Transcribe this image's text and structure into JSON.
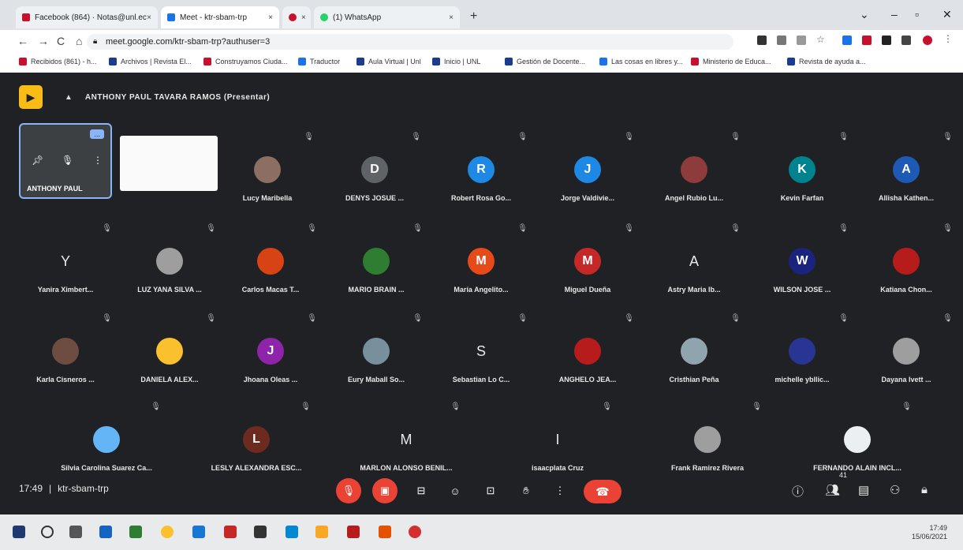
{
  "browser": {
    "tabs": [
      {
        "label": "Facebook (864) · Notas@unl.ec",
        "fav": "#c8102e",
        "active": false
      },
      {
        "label": "Meet - ktr-sbam-trp",
        "fav": "#1a73e8",
        "active": true
      },
      {
        "label": "",
        "fav": "#c8102e",
        "active": false
      },
      {
        "label": "(1) WhatsApp",
        "fav": "#25d366",
        "active": false
      }
    ],
    "url": "meet.google.com/ktr-sbam-trp?authuser=3",
    "bookmarks": [
      {
        "label": "Recibidos (861) - h...",
        "color": "#c8102e"
      },
      {
        "label": "Archivos | Revista El...",
        "color": "#1a3c8c"
      },
      {
        "label": "Construyamos Ciuda...",
        "color": "#c8102e"
      },
      {
        "label": "Traductor",
        "color": "#1a73e8"
      },
      {
        "label": "Aula Virtual | Unl",
        "color": "#1a3c8c"
      },
      {
        "label": "Inicio | UNL",
        "color": "#1a3c8c"
      },
      {
        "label": "Gestión de Docente...",
        "color": "#1a3c8c"
      },
      {
        "label": "Las cosas en libres y...",
        "color": "#1a73e8"
      },
      {
        "label": "Ministerio de Educa...",
        "color": "#c8102e"
      },
      {
        "label": "Revista de ayuda a...",
        "color": "#1a3c8c"
      }
    ]
  },
  "meet": {
    "presenter": "ANTHONY PAUL TAVARA RAMOS (Presentar)",
    "self_name": "ANTHONY PAUL",
    "self_badge": "...",
    "participants": [
      {
        "name": "Lucy Maribella",
        "initial": "",
        "color": "#8d6e63"
      },
      {
        "name": "DENYS JOSUE ...",
        "initial": "D",
        "color": "#5f6368"
      },
      {
        "name": "Robert Rosa Go...",
        "initial": "R",
        "color": "#1e88e5"
      },
      {
        "name": "Jorge Valdivie...",
        "initial": "J",
        "color": "#1e88e5"
      },
      {
        "name": "Angel Rubio Lu...",
        "initial": "",
        "color": "#8e3b3b"
      },
      {
        "name": "Kevin Farfan",
        "initial": "K",
        "color": "#00838f"
      },
      {
        "name": "Allisha Kathen...",
        "initial": "A",
        "color": "#1e5ab4"
      },
      {
        "name": "Yanira Ximbert...",
        "initial": "Y",
        "color": "letter"
      },
      {
        "name": "LUZ YANA SILVA ...",
        "initial": "",
        "color": "#9e9e9e"
      },
      {
        "name": "Carlos Macas T...",
        "initial": "",
        "color": "#d84315"
      },
      {
        "name": "MARIO BRAIN ...",
        "initial": "",
        "color": "#2e7d32"
      },
      {
        "name": "María Angelito...",
        "initial": "M",
        "color": "#e64a19"
      },
      {
        "name": "Miguel Dueña",
        "initial": "M",
        "color": "#c62828"
      },
      {
        "name": "Astry Maria Ib...",
        "initial": "A",
        "color": "letter"
      },
      {
        "name": "WILSON JOSE ...",
        "initial": "W",
        "color": "#1a237e"
      },
      {
        "name": "Katiana Chon...",
        "initial": "",
        "color": "#b71c1c"
      },
      {
        "name": "Karla Cisneros ...",
        "initial": "",
        "color": "#6d4c41"
      },
      {
        "name": "DANIELA ALEX...",
        "initial": "",
        "color": "#fbc02d"
      },
      {
        "name": "Jhoana Oleas ...",
        "initial": "J",
        "color": "#8e24aa"
      },
      {
        "name": "Eury Maball So...",
        "initial": "",
        "color": "#78909c"
      },
      {
        "name": "Sebastian Lo C...",
        "initial": "S",
        "color": "letter"
      },
      {
        "name": "ANGHELO JEA...",
        "initial": "",
        "color": "#b71c1c"
      },
      {
        "name": "Cristhian Peña",
        "initial": "",
        "color": "#90a4ae"
      },
      {
        "name": "michelle ybllic...",
        "initial": "",
        "color": "#283593"
      },
      {
        "name": "Dayana Ivett ...",
        "initial": "",
        "color": "#9e9e9e"
      }
    ],
    "last_row": [
      {
        "name": "Silvia Carolina Suarez Ca...",
        "initial": "",
        "color": "#64b5f6"
      },
      {
        "name": "LESLY ALEXANDRA ESC...",
        "initial": "L",
        "color": "#6d2b1f"
      },
      {
        "name": "MARLON ALONSO BENIL...",
        "initial": "M",
        "color": "letter"
      },
      {
        "name": "isaacplata Cruz",
        "initial": "I",
        "color": "letter"
      },
      {
        "name": "Frank Ramirez Rivera",
        "initial": "",
        "color": "#9e9e9e"
      },
      {
        "name": "FERNANDO ALAIN INCL...",
        "initial": "",
        "color": "#eceff1"
      }
    ],
    "time": "17:49",
    "meeting_code": "ktr-sbam-trp",
    "participant_count": "41"
  },
  "taskbar": {
    "time": "17:49",
    "date": "15/06/2021"
  }
}
